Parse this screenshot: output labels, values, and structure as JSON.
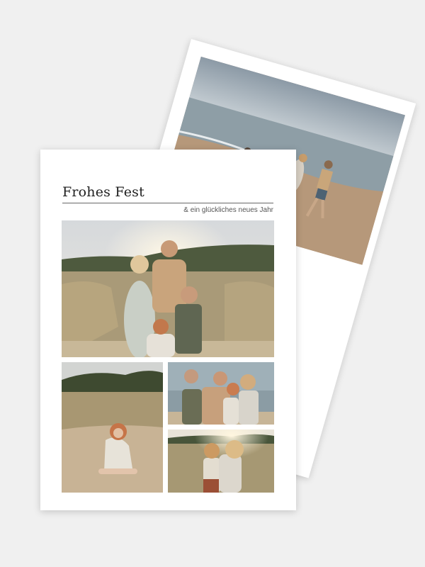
{
  "front_card": {
    "title": "Frohes Fest",
    "subtitle": "& ein glückliches neues Jahr"
  },
  "colors": {
    "background": "#f0f0f0",
    "card": "#ffffff",
    "title_text": "#1f1f1f"
  },
  "photos": [
    "beach-family-walk-photo",
    "family-portrait-dunes-photo",
    "girl-sitting-sand-photo",
    "family-hug-photo",
    "mother-daughter-photo"
  ]
}
